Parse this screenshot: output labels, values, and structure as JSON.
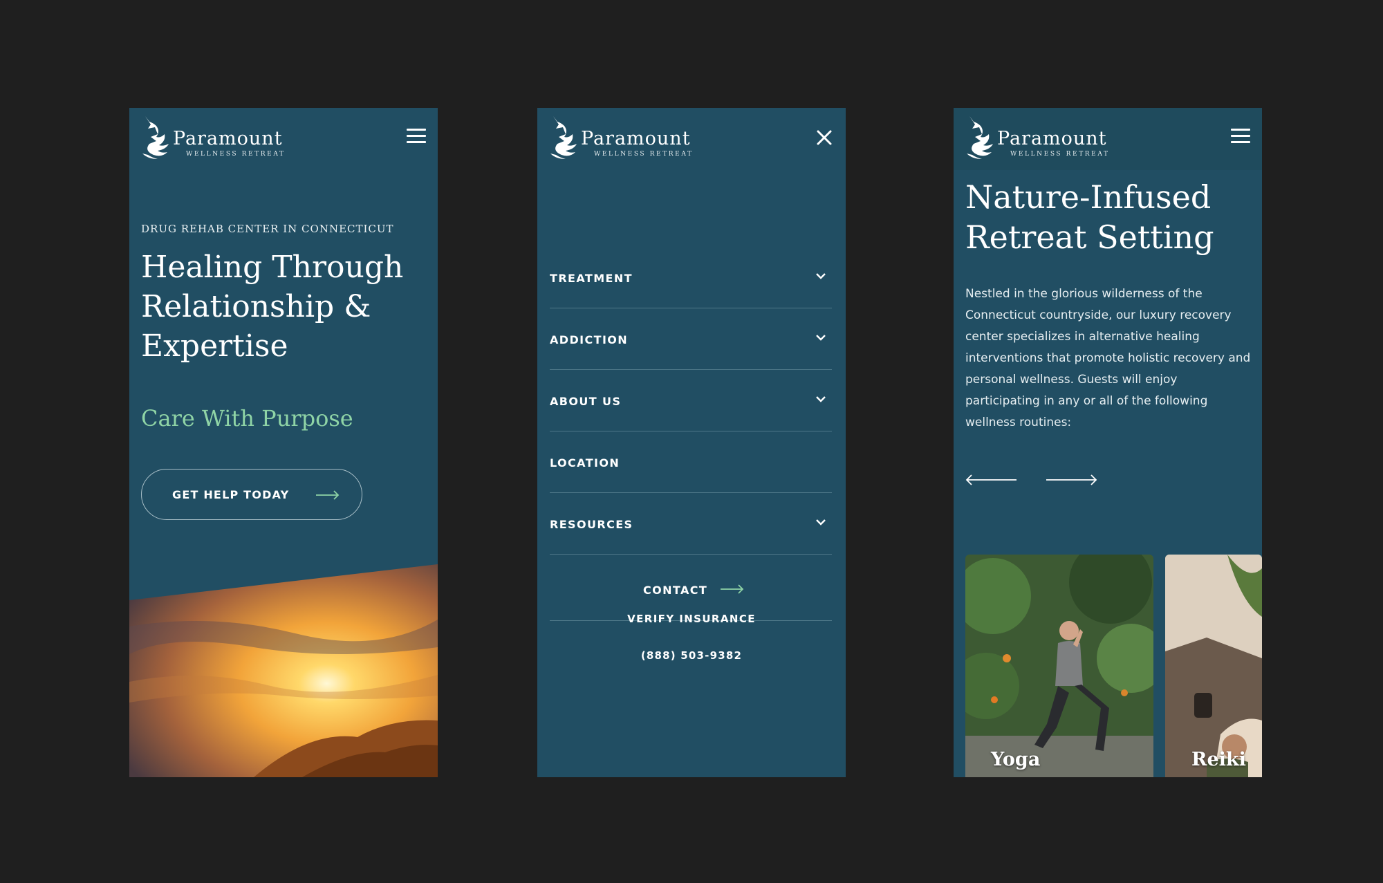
{
  "brand": {
    "name": "Paramount",
    "tagline": "WELLNESS RETREAT"
  },
  "hero": {
    "eyebrow": "DRUG REHAB CENTER IN CONNECTICUT",
    "heading": "Healing Through Relationship & Expertise",
    "tagline": "Care With Purpose",
    "cta_label": "GET HELP TODAY"
  },
  "menu": {
    "items": [
      {
        "label": "TREATMENT",
        "has_submenu": true
      },
      {
        "label": "ADDICTION",
        "has_submenu": true
      },
      {
        "label": "ABOUT US",
        "has_submenu": true
      },
      {
        "label": "LOCATION",
        "has_submenu": false
      },
      {
        "label": "RESOURCES",
        "has_submenu": true
      }
    ],
    "contact_label": "CONTACT",
    "verify_label": "VERIFY INSURANCE",
    "phone": "(888) 503-9382"
  },
  "retreat": {
    "heading": "Nature-Infused Retreat Setting",
    "body": "Nestled in the glorious wilderness of the Connecticut countryside, our luxury recovery center specializes in alternative healing interventions that promote holistic recovery and personal wellness. Guests will enjoy participating in any or all of the following wellness routines:",
    "cards": [
      {
        "label": "Yoga"
      },
      {
        "label": "Reiki"
      }
    ]
  },
  "colors": {
    "page_bg": "#1f1f1f",
    "panel_bg": "#214e63",
    "accent_green": "#8fd4a6",
    "text": "#ffffff"
  },
  "icons": [
    "menu-icon",
    "close-icon",
    "chevron-down-icon",
    "arrow-right-icon",
    "arrow-left-icon",
    "logo-mark-icon"
  ]
}
